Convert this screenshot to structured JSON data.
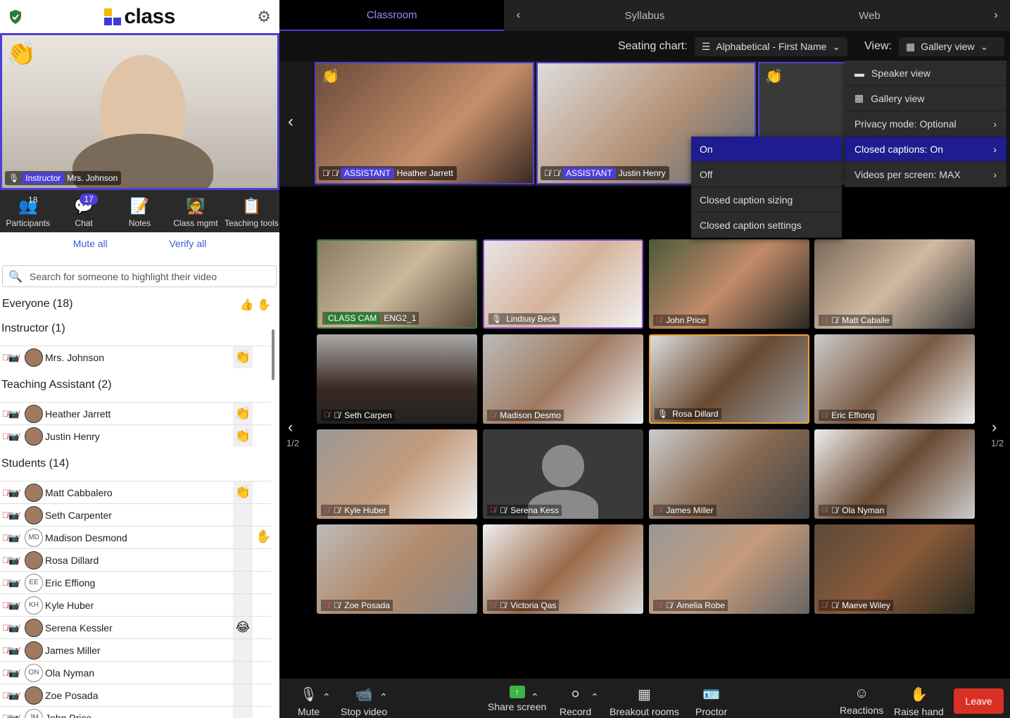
{
  "app": {
    "logo_text": "class"
  },
  "instructor_tile": {
    "role": "Instructor",
    "name": "Mrs. Johnson"
  },
  "tools": [
    {
      "label": "Participants",
      "count": "18"
    },
    {
      "label": "Chat",
      "badge": "17"
    },
    {
      "label": "Notes"
    },
    {
      "label": "Class mgmt"
    },
    {
      "label": "Teaching tools"
    }
  ],
  "actions": {
    "mute_all": "Mute all",
    "verify_all": "Verify all"
  },
  "search": {
    "placeholder": "Search for someone to highlight their video"
  },
  "everyone": {
    "label": "Everyone (18)"
  },
  "sections": {
    "instructor": {
      "title": "Instructor (1)",
      "people": [
        {
          "name": "Mrs. Johnson",
          "initials": ""
        }
      ]
    },
    "ta": {
      "title": "Teaching Assistant (2)",
      "people": [
        {
          "name": "Heather Jarrett"
        },
        {
          "name": "Justin Henry"
        }
      ]
    },
    "students": {
      "title": "Students (14)",
      "people": [
        {
          "name": "Matt Cabbalero",
          "initials": ""
        },
        {
          "name": "Seth Carpenter",
          "initials": ""
        },
        {
          "name": "Madison Desmond",
          "initials": "MD"
        },
        {
          "name": "Rosa Dillard",
          "initials": ""
        },
        {
          "name": "Eric Effiong",
          "initials": "EE"
        },
        {
          "name": "Kyle Huber",
          "initials": "KH"
        },
        {
          "name": "Serena Kessler",
          "initials": ""
        },
        {
          "name": "James Miller",
          "initials": ""
        },
        {
          "name": "Ola Nyman",
          "initials": "ON"
        },
        {
          "name": "Zoe Posada",
          "initials": ""
        },
        {
          "name": "John Price",
          "initials": "JM"
        }
      ]
    }
  },
  "tabs": {
    "classroom": "Classroom",
    "syllabus": "Syllabus",
    "web": "Web"
  },
  "controls": {
    "seating_label": "Seating chart:",
    "seating_value": "Alphabetical - First Name",
    "view_label": "View:",
    "view_value": "Gallery view"
  },
  "strip": [
    {
      "role": "ASSISTANT",
      "name": "Heather Jarrett"
    },
    {
      "role": "ASSISTANT",
      "name": "Justin Henry"
    }
  ],
  "view_menu": [
    {
      "label": "Speaker view"
    },
    {
      "label": "Gallery view"
    },
    {
      "label": "Privacy mode: Optional"
    },
    {
      "label": "Closed captions: On"
    },
    {
      "label": "Videos per screen: MAX"
    }
  ],
  "caption_menu": [
    {
      "label": "On"
    },
    {
      "label": "Off"
    },
    {
      "label": "Closed caption sizing"
    },
    {
      "label": "Closed caption settings"
    }
  ],
  "grid": [
    {
      "name": "ENG2_1",
      "badge": "CLASS CAM"
    },
    {
      "name": "Lindsay Beck"
    },
    {
      "name": "John Price"
    },
    {
      "name": "Matt Caballe"
    },
    {
      "name": "Seth Carpen"
    },
    {
      "name": "Madison Desmo"
    },
    {
      "name": "Rosa Dillard"
    },
    {
      "name": "Eric Effiong"
    },
    {
      "name": "Kyle Huber"
    },
    {
      "name": "Serena Kess"
    },
    {
      "name": "James Miller"
    },
    {
      "name": "Ola Nyman"
    },
    {
      "name": "Zoe Posada"
    },
    {
      "name": "Victoria Qas"
    },
    {
      "name": "Amelia Robe"
    },
    {
      "name": "Maeve Wiley"
    }
  ],
  "pagination": {
    "left": "1/2",
    "right": "1/2"
  },
  "bottombar": {
    "mute": "Mute",
    "stop_video": "Stop video",
    "share": "Share screen",
    "record": "Record",
    "breakout": "Breakout rooms",
    "proctor": "Proctor",
    "reactions": "Reactions",
    "raise_hand": "Raise hand",
    "leave": "Leave"
  },
  "colors": {
    "accent": "#4b3fd6",
    "leave": "#d93025",
    "highlight": "#1e1c8e",
    "share": "#3bb543"
  }
}
